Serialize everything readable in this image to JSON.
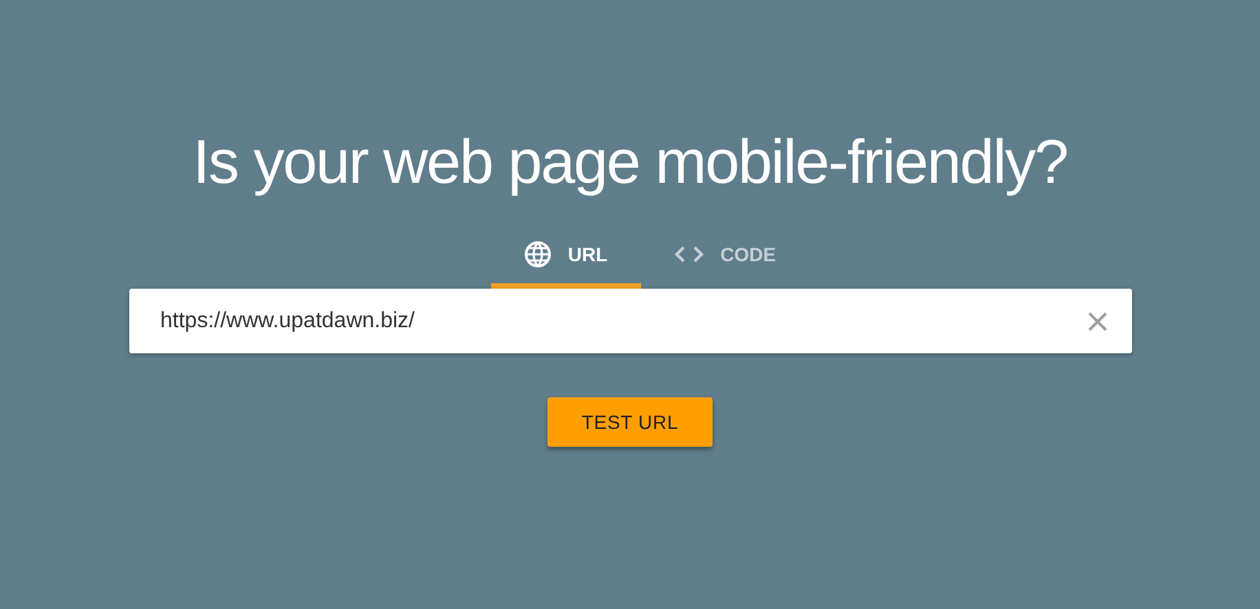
{
  "title": "Is your web page mobile-friendly?",
  "tabs": [
    {
      "label": "URL",
      "kind": "globe",
      "selected": true
    },
    {
      "label": "CODE",
      "kind": "code",
      "selected": false
    }
  ],
  "url_field": {
    "value": "https://www.upatdawn.biz/"
  },
  "button": "TEST URL"
}
